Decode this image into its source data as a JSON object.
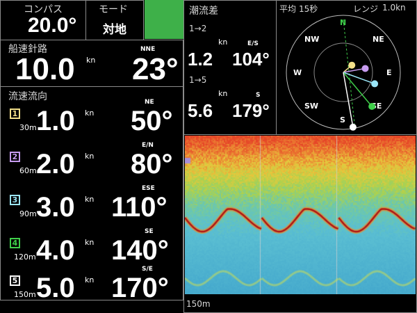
{
  "compass": {
    "label": "コンパス",
    "value": "20.0°"
  },
  "mode": {
    "label": "モード",
    "value": "対地"
  },
  "ship": {
    "label": "船速針路",
    "speed": "10.0",
    "unit": "kn",
    "dir_label": "NNE",
    "heading": "23°"
  },
  "current": {
    "label": "流速流向",
    "layers": [
      {
        "num": "1",
        "depth": "30m",
        "speed": "1.0",
        "unit": "kn",
        "dir_label": "NE",
        "dir": "50°",
        "color": "#f4e08a"
      },
      {
        "num": "2",
        "depth": "60m",
        "speed": "2.0",
        "unit": "kn",
        "dir_label": "E/N",
        "dir": "80°",
        "color": "#c79cf0"
      },
      {
        "num": "3",
        "depth": "90m",
        "speed": "3.0",
        "unit": "kn",
        "dir_label": "ESE",
        "dir": "110°",
        "color": "#9be6f7"
      },
      {
        "num": "4",
        "depth": "120m",
        "speed": "4.0",
        "unit": "kn",
        "dir_label": "SE",
        "dir": "140°",
        "color": "#3fcf4a"
      },
      {
        "num": "5",
        "depth": "150m",
        "speed": "5.0",
        "unit": "kn",
        "dir_label": "S/E",
        "dir": "170°",
        "color": "#ffffff"
      }
    ]
  },
  "tide_diff": {
    "label": "潮流差",
    "rows": [
      {
        "range": "1→2",
        "speed": "1.2",
        "unit": "kn",
        "dir_label": "E/S",
        "dir": "104°"
      },
      {
        "range": "1→5",
        "speed": "5.6",
        "unit": "kn",
        "dir_label": "S",
        "dir": "179°"
      }
    ]
  },
  "vector": {
    "avg_label": "平均",
    "avg_value": "15秒",
    "range_label": "レンジ",
    "range_value": "1.0kn",
    "labels": {
      "n": "N",
      "ne": "NE",
      "e": "E",
      "se": "SE",
      "s": "S",
      "sw": "SW",
      "w": "W",
      "nw": "NW"
    },
    "vectors": [
      {
        "layer": "1",
        "dir_deg": 50,
        "speed_kn": 1.0,
        "color": "#f4e08a"
      },
      {
        "layer": "2",
        "dir_deg": 80,
        "speed_kn": 2.0,
        "color": "#c79cf0"
      },
      {
        "layer": "3",
        "dir_deg": 110,
        "speed_kn": 3.0,
        "color": "#9be6f7"
      },
      {
        "layer": "4",
        "dir_deg": 140,
        "speed_kn": 4.0,
        "color": "#3fcf4a"
      },
      {
        "layer": "5",
        "dir_deg": 170,
        "speed_kn": 5.0,
        "color": "#ffffff"
      }
    ]
  },
  "echo": {
    "depth_label": "150m"
  },
  "colors": {
    "green_accent": "#3eb049",
    "frame": "#8a8a8a"
  }
}
